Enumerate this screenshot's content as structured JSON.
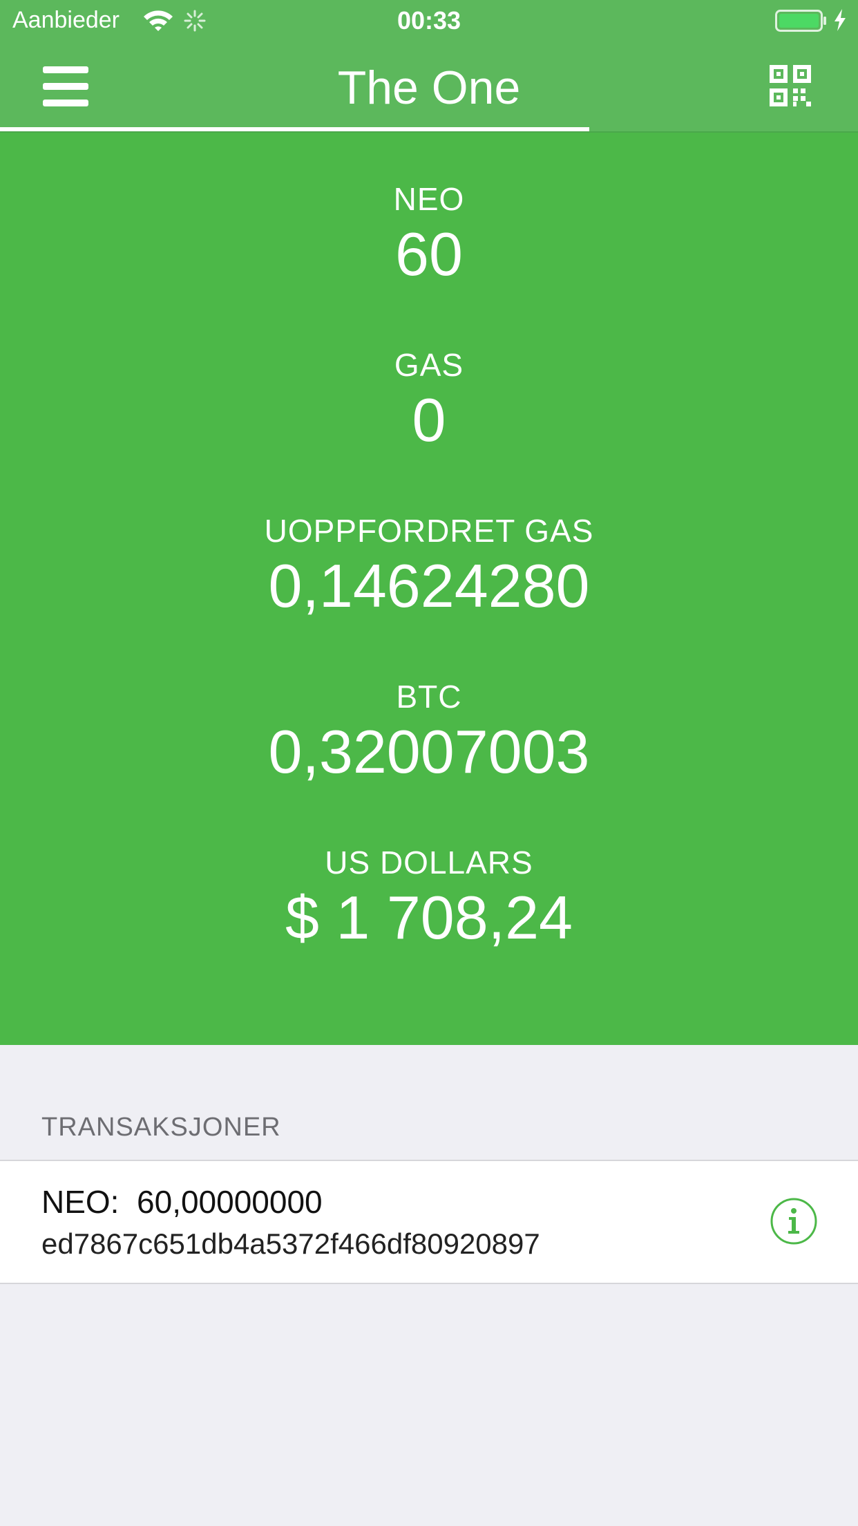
{
  "status_bar": {
    "carrier": "Aanbieder",
    "time": "00:33"
  },
  "nav": {
    "title": "The One",
    "left_icon": "menu-icon",
    "right_icon": "qr-code-icon"
  },
  "balances": [
    {
      "label": "NEO",
      "value": "60"
    },
    {
      "label": "GAS",
      "value": "0"
    },
    {
      "label": "UOPPFORDRET GAS",
      "value": "0,14624280"
    },
    {
      "label": "BTC",
      "value": "0,32007003"
    },
    {
      "label": "US DOLLARS",
      "value": "$ 1 708,24"
    }
  ],
  "transactions": {
    "header": "TRANSAKSJONER",
    "items": [
      {
        "amount": "NEO:  60,00000000",
        "hash": "ed7867c651db4a5372f466df80920897"
      }
    ]
  },
  "colors": {
    "nav_green": "#5cb85c",
    "balance_green": "#4cb848",
    "background": "#efeff4"
  }
}
